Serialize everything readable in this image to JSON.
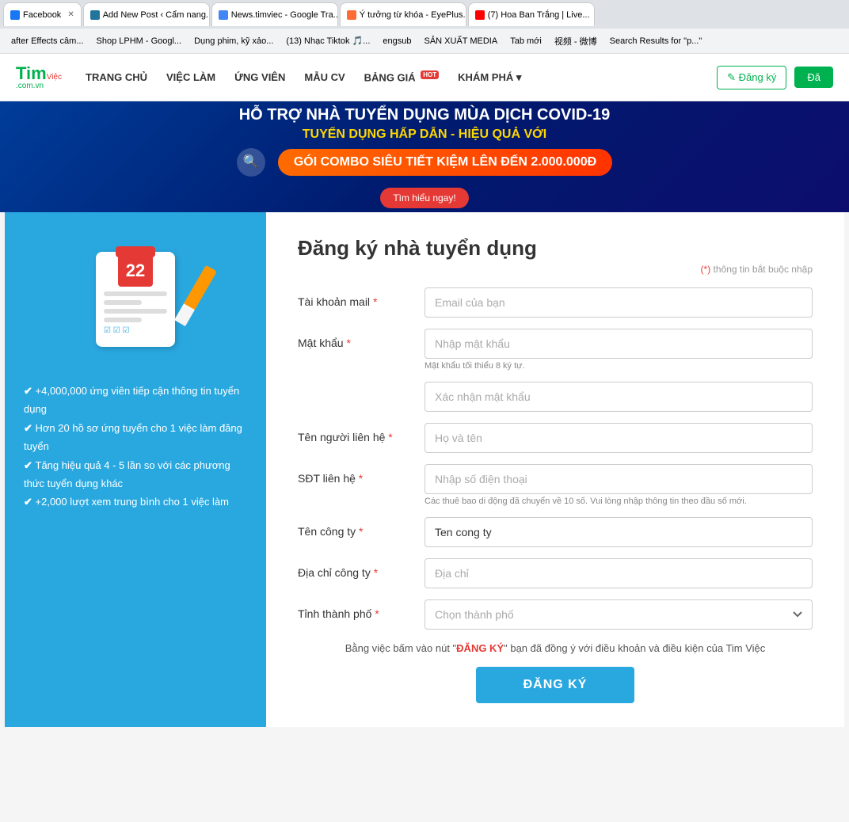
{
  "browser": {
    "tabs": [
      {
        "id": "fb",
        "label": "Facebook",
        "color": "#1877f2",
        "active": false
      },
      {
        "id": "addpost",
        "label": "Add New Post ‹ Cẩm nang...",
        "color": "#21759b",
        "active": false
      },
      {
        "id": "news",
        "label": "News.timviec - Google Tra...",
        "color": "#4285f4",
        "active": true
      },
      {
        "id": "eyeplus",
        "label": "Ý tưởng từ khóa - EyePlus...",
        "color": "#ff6b35",
        "active": false
      },
      {
        "id": "youtube",
        "label": "(7) Hoa Ban Trắng | Live...",
        "color": "#ff0000",
        "active": false
      }
    ],
    "bookmarks": [
      {
        "id": "bk1",
        "label": "after Effects câm..."
      },
      {
        "id": "bk2",
        "label": "Shop LPHM - Googl..."
      },
      {
        "id": "bk3",
        "label": "Dụng phim, kỹ xảo..."
      },
      {
        "id": "bk4",
        "label": "(13) Nhạc Tiktok 🎵..."
      },
      {
        "id": "bk5",
        "label": "engsub"
      },
      {
        "id": "bk6",
        "label": "SẢN XUẤT MEDIA"
      },
      {
        "id": "bk7",
        "label": "Tab mới"
      },
      {
        "id": "bk8",
        "label": "视频 - 微博"
      },
      {
        "id": "bk9",
        "label": "Search Results for \"p...\""
      }
    ]
  },
  "header": {
    "logo_top": "Tim",
    "logo_vim": "Việc",
    "logo_sub": ".com.vn",
    "nav": [
      {
        "id": "trangchu",
        "label": "TRANG CHỦ",
        "hot": false
      },
      {
        "id": "vieclam",
        "label": "VIỆC LÀM",
        "hot": false
      },
      {
        "id": "ungvien",
        "label": "ỨNG VIÊN",
        "hot": false
      },
      {
        "id": "maucv",
        "label": "MẪU CV",
        "hot": false
      },
      {
        "id": "banggia",
        "label": "BẢNG GIÁ",
        "hot": true
      },
      {
        "id": "khampha",
        "label": "KHÁM PHÁ ▾",
        "hot": false
      }
    ],
    "hot_label": "HOT",
    "btn_register": "✎ Đăng ký",
    "btn_login": "Đă"
  },
  "banner": {
    "line1": "HỖ TRỢ NHÀ TUYỂN DỤNG MÙA DỊCH COVID-19",
    "line2": "TUYỂN DỤNG HẤP DẪN - HIỆU QUẢ VỚI",
    "combo_text": "GÓI COMBO SIÊU TIẾT KIỆM LÊN ĐẾN 2.000.000Đ",
    "learn_more": "Tìm hiểu ngay!"
  },
  "left_panel": {
    "features": [
      "+4,000,000 ứng viên tiếp cận thông tin tuyển dụng",
      "Hơn 20 hồ sơ ứng tuyển cho 1 việc làm đăng tuyển",
      "Tăng hiệu quả 4 - 5 lần so với các phương thức tuyển dụng khác",
      "+2,000 lượt xem trung bình cho 1 việc làm"
    ]
  },
  "form": {
    "title": "Đăng ký nhà tuyển dụng",
    "required_note": "(*) thông tin bắt buộc nhập",
    "fields": {
      "email_label": "Tài khoản mail",
      "email_placeholder": "Email của bạn",
      "password_label": "Mật khẩu",
      "password_placeholder": "Nhập mật khẩu",
      "password_hint": "Mật khẩu tối thiểu 8 ký tự.",
      "confirm_placeholder": "Xác nhận mật khẩu",
      "contact_label": "Tên người liên hệ",
      "contact_placeholder": "Họ và tên",
      "phone_label": "SĐT liên hệ",
      "phone_placeholder": "Nhập số điện thoại",
      "phone_hint": "Các thuê bao di động đã chuyển về 10 số. Vui lòng nhập thông tin theo đầu số mới.",
      "company_label": "Tên công ty",
      "company_placeholder": "Tên công ty",
      "company_value": "Ten cong ty",
      "address_label": "Địa chỉ công ty",
      "address_placeholder": "Địa chỉ",
      "city_label": "Tỉnh thành phố",
      "city_placeholder": "Chọn thành phố"
    },
    "terms_text_before": "Bằng việc bấm vào nút \"",
    "terms_link": "ĐĂNG KÝ",
    "terms_text_after": "\" bạn đã đồng ý với điều khoản và điều kiện của Tim Việc",
    "submit_label": "ĐĂNG KÝ"
  }
}
